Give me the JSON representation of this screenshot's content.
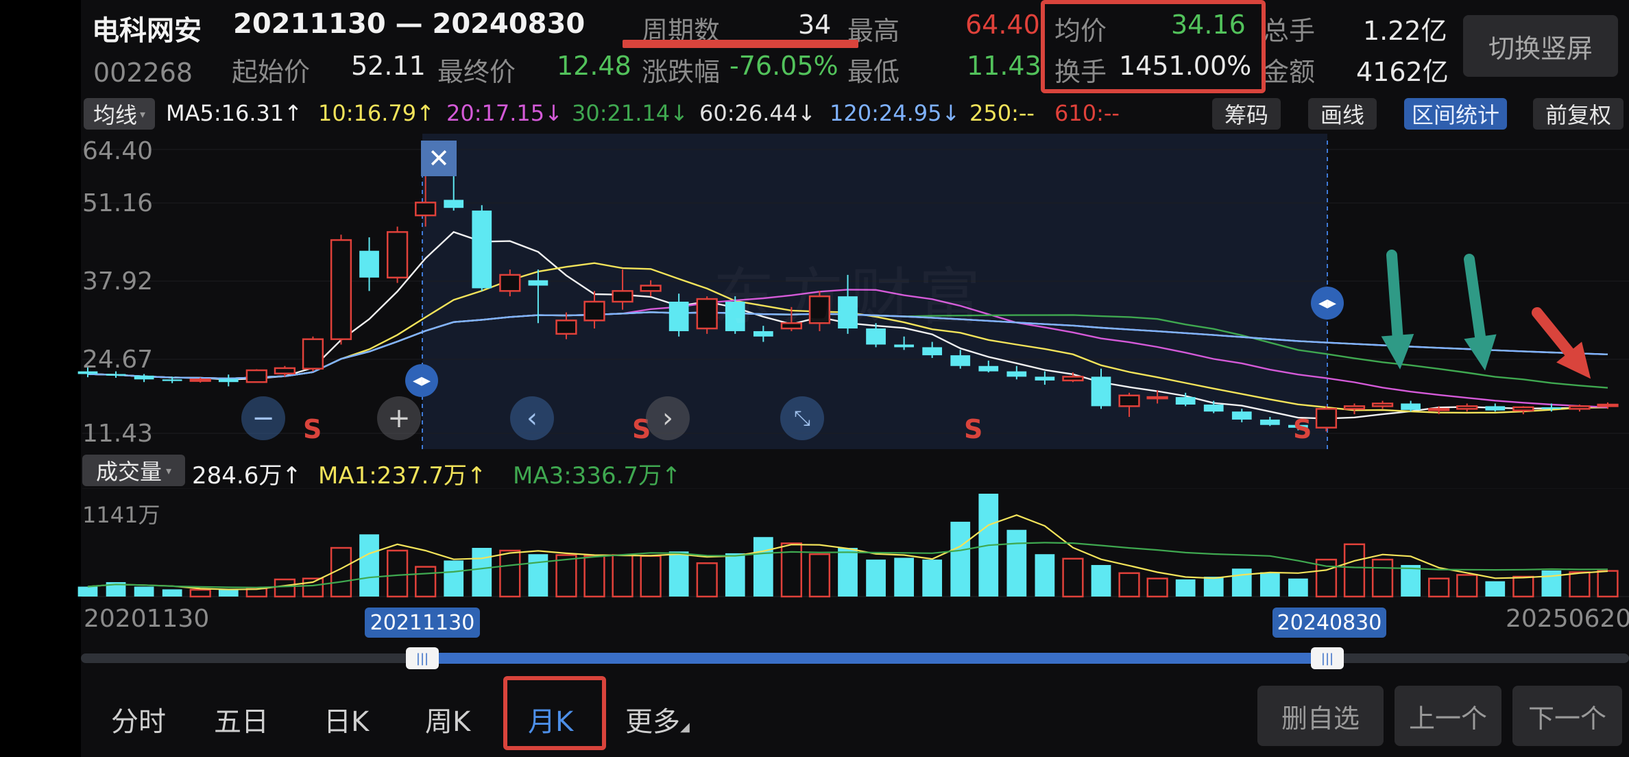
{
  "header": {
    "stock_name": "电科网安",
    "stock_code": "002268",
    "date_range": "20211130 — 20240830",
    "stats": {
      "periods_label": "周期数",
      "periods_value": "34",
      "high_label": "最高",
      "high_value": "64.40",
      "avg_label": "均价",
      "avg_value": "34.16",
      "total_vol_label": "总手",
      "total_vol_value": "1.22亿",
      "start_label": "起始价",
      "start_value": "52.11",
      "end_label": "最终价",
      "end_value": "12.48",
      "change_label": "涨跌幅",
      "change_value": "-76.05%",
      "low_label": "最低",
      "low_value": "11.43",
      "turnover_label": "换手",
      "turnover_value": "1451.00%",
      "amount_label": "金额",
      "amount_value": "4162亿"
    },
    "switch_button": "切换竖屏"
  },
  "ma_bar": {
    "selector": "均线",
    "items": [
      {
        "text": "MA5:16.31↑",
        "color": "#f0f0f0"
      },
      {
        "text": "10:16.79↑",
        "color": "#f2e35a"
      },
      {
        "text": "20:17.15↓",
        "color": "#d45ad8"
      },
      {
        "text": "30:21.14↓",
        "color": "#3fa850"
      },
      {
        "text": "60:26.44↓",
        "color": "#e0e0e0"
      },
      {
        "text": "120:24.95↓",
        "color": "#7fb2ff"
      },
      {
        "text": "250:--",
        "color": "#f2e35a"
      },
      {
        "text": "610:--",
        "color": "#e0413a"
      }
    ],
    "tools": [
      "筹码",
      "画线",
      "区间统计",
      "前复权"
    ]
  },
  "price_axis": [
    "64.40",
    "51.16",
    "37.92",
    "24.67",
    "11.43"
  ],
  "s_marks": [
    "S",
    "S",
    "S",
    "S"
  ],
  "volume_bar": {
    "selector": "成交量",
    "volume": "284.6万↑",
    "ma1": "MA1:237.7万↑",
    "ma3": "MA3:336.7万↑",
    "axis_max": "1141万"
  },
  "timeline": {
    "start": "20201130",
    "end": "20250620",
    "range_start": "20211130",
    "range_end": "20240830"
  },
  "tabs": [
    "分时",
    "五日",
    "日K",
    "周K",
    "月K",
    "更多"
  ],
  "active_tab": "月K",
  "bottom_buttons": [
    "删自选",
    "上一个",
    "下一个"
  ],
  "watermark": "东方财富",
  "chart_data": {
    "type": "candlestick",
    "period": "monthly",
    "price_range": [
      11.43,
      64.4
    ],
    "volume_max_label": "1141万",
    "candles_ohlc": [
      [
        23.0,
        23.8,
        21.9,
        22.5
      ],
      [
        22.5,
        23.0,
        21.8,
        22.2
      ],
      [
        22.2,
        22.5,
        21.0,
        21.5
      ],
      [
        21.5,
        22.0,
        20.8,
        21.2
      ],
      [
        21.2,
        21.8,
        20.9,
        21.5
      ],
      [
        21.6,
        22.4,
        20.2,
        21.0
      ],
      [
        21.0,
        23.4,
        20.9,
        23.2
      ],
      [
        22.6,
        24.0,
        22.0,
        23.6
      ],
      [
        23.5,
        29.5,
        23.0,
        29.0
      ],
      [
        29.0,
        48.5,
        28.0,
        47.5
      ],
      [
        45.5,
        48.0,
        38.0,
        40.5
      ],
      [
        40.5,
        50.0,
        39.5,
        49.0
      ],
      [
        52.1,
        64.4,
        50.0,
        54.5
      ],
      [
        55.0,
        62.0,
        53.0,
        53.5
      ],
      [
        53.0,
        54.0,
        38.0,
        38.5
      ],
      [
        38.0,
        42.0,
        37.0,
        41.0
      ],
      [
        40.0,
        42.0,
        32.0,
        39.0
      ],
      [
        30.0,
        34.0,
        29.0,
        32.5
      ],
      [
        32.5,
        38.0,
        31.0,
        36.0
      ],
      [
        36.0,
        42.0,
        34.5,
        38.0
      ],
      [
        38.0,
        40.0,
        37.0,
        39.0
      ],
      [
        36.0,
        37.5,
        29.5,
        30.5
      ],
      [
        31.0,
        37.0,
        30.0,
        36.5
      ],
      [
        36.0,
        37.0,
        30.0,
        30.5
      ],
      [
        30.5,
        31.5,
        28.5,
        29.5
      ],
      [
        31.0,
        35.0,
        30.5,
        32.0
      ],
      [
        32.0,
        38.0,
        30.5,
        37.0
      ],
      [
        37.0,
        41.0,
        30.0,
        31.0
      ],
      [
        31.0,
        32.0,
        27.5,
        28.0
      ],
      [
        28.0,
        29.5,
        27.0,
        27.5
      ],
      [
        27.5,
        28.5,
        25.5,
        26.0
      ],
      [
        26.0,
        27.0,
        23.5,
        24.0
      ],
      [
        24.0,
        25.0,
        22.8,
        23.0
      ],
      [
        23.0,
        24.0,
        21.5,
        22.0
      ],
      [
        22.0,
        23.0,
        20.5,
        21.3
      ],
      [
        21.3,
        22.8,
        21.0,
        22.0
      ],
      [
        22.0,
        23.5,
        16.0,
        16.5
      ],
      [
        16.5,
        19.0,
        14.5,
        18.5
      ],
      [
        18.0,
        19.5,
        17.0,
        18.2
      ],
      [
        18.2,
        19.0,
        16.5,
        16.8
      ],
      [
        16.8,
        17.5,
        15.2,
        15.5
      ],
      [
        15.5,
        16.0,
        13.5,
        14.0
      ],
      [
        14.0,
        14.5,
        12.8,
        13.0
      ],
      [
        13.0,
        13.3,
        12.0,
        12.48
      ],
      [
        12.5,
        16.5,
        11.8,
        16.0
      ],
      [
        16.0,
        17.0,
        15.0,
        16.5
      ],
      [
        16.5,
        17.5,
        16.0,
        17.0
      ],
      [
        17.0,
        17.5,
        15.5,
        15.8
      ],
      [
        15.8,
        16.5,
        15.0,
        16.0
      ],
      [
        16.0,
        17.0,
        15.5,
        16.5
      ],
      [
        16.5,
        17.0,
        15.5,
        15.7
      ],
      [
        15.7,
        16.5,
        15.0,
        16.3
      ],
      [
        16.3,
        17.0,
        15.5,
        16.0
      ],
      [
        16.0,
        16.8,
        15.5,
        16.5
      ],
      [
        16.5,
        17.2,
        16.0,
        16.8
      ]
    ],
    "volumes_wan": [
      110,
      160,
      110,
      80,
      75,
      80,
      90,
      190,
      200,
      540,
      690,
      510,
      330,
      400,
      540,
      510,
      470,
      460,
      450,
      460,
      450,
      500,
      370,
      480,
      660,
      590,
      470,
      540,
      410,
      430,
      410,
      830,
      1141,
      740,
      470,
      420,
      350,
      260,
      200,
      190,
      220,
      310,
      270,
      200,
      410,
      580,
      410,
      350,
      200,
      240,
      170,
      220,
      290,
      270,
      284.6
    ],
    "selected_range": [
      "20211130",
      "20240830"
    ]
  }
}
